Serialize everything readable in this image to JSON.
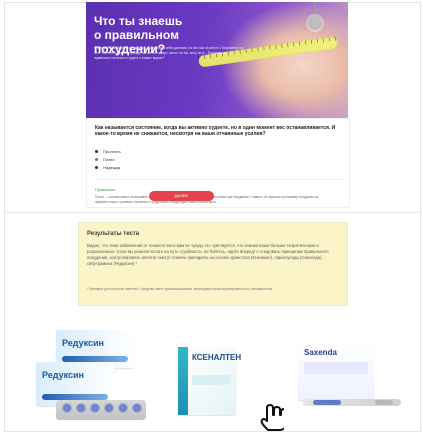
{
  "hero": {
    "title_line1": "Что ты знаешь",
    "title_line2": "о правильном похудении?",
    "text": "Я каждый божий день я стараюсь, я измучила себя диетами, но вес как на месте. Получается ли это? Хотела бы узнать правду, так же ли скажут: много ли ем, могу ли я... Придется ли правильно питаться и худеть о ваших вкусах?"
  },
  "question": {
    "title": "Как называется состояние, когда вы активно худеете, но в один момент вес останавливается. И какое-то время не снижается, несмотря на ваши отчаянные усилия?",
    "options": [
      "Пролесть",
      "Плато",
      "Надежда"
    ],
    "selected_index": 1,
    "answer_label": "Правильно",
    "answer_text": "Плато — похоже место на вершине горы. Многие так называют — точно стоимость веса при похудении. Главное, не бросить программу похудения на эффекте плато, проявить терпение и продолжить следующий этапы сброса веса.",
    "next_label": "ДАЛЕЕ"
  },
  "results": {
    "title": "Результаты теста",
    "text": "Видно, что тема избавления от лишнего веса вам не чужда. Но чувствуется, что знания ваши больше теоретические и разрозненные. Если вы решили встать на путь стройности, не бойтесь, идите вперед! А следовать принципам правильного похудения, контролировать аппетит смогут помочь препараты на основе орлистата (Ксеникал), лираглутида (Саксенда), сибутрамина (Редуксин) *.",
    "note": "* Препарат для контроля аппетита. Средство имеет противопоказания, необходимо проконсультироваться со специалистом."
  },
  "products": {
    "reduxin_name": "Редуксин",
    "xenalten_name": "КСЕНАЛТЕН",
    "saxenda_name": "Saxenda"
  },
  "icons": {
    "hand": "hand-pointer-icon"
  }
}
